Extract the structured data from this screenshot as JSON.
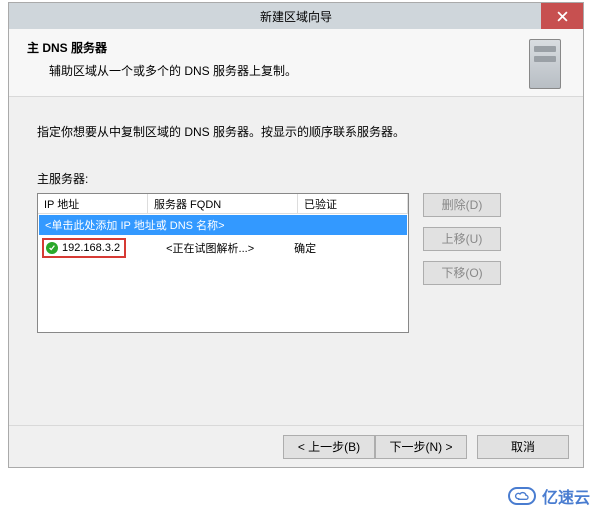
{
  "window": {
    "title": "新建区域向导"
  },
  "header": {
    "heading": "主 DNS 服务器",
    "subtext": "辅助区域从一个或多个的 DNS 服务器上复制。"
  },
  "instruction": "指定你想要从中复制区域的 DNS 服务器。按显示的顺序联系服务器。",
  "servers": {
    "label": "主服务器:",
    "columns": {
      "ip": "IP 地址",
      "fqdn": "服务器 FQDN",
      "validated": "已验证"
    },
    "add_hint": "<单击此处添加 IP 地址或 DNS 名称>",
    "rows": [
      {
        "ip": "192.168.3.2",
        "fqdn": "<正在试图解析...>",
        "validated": "确定",
        "status": "ok"
      }
    ]
  },
  "buttons": {
    "delete": "删除(D)",
    "up": "上移(U)",
    "down": "下移(O)",
    "back": "< 上一步(B)",
    "next": "下一步(N) >",
    "cancel": "取消"
  },
  "watermark": "亿速云"
}
